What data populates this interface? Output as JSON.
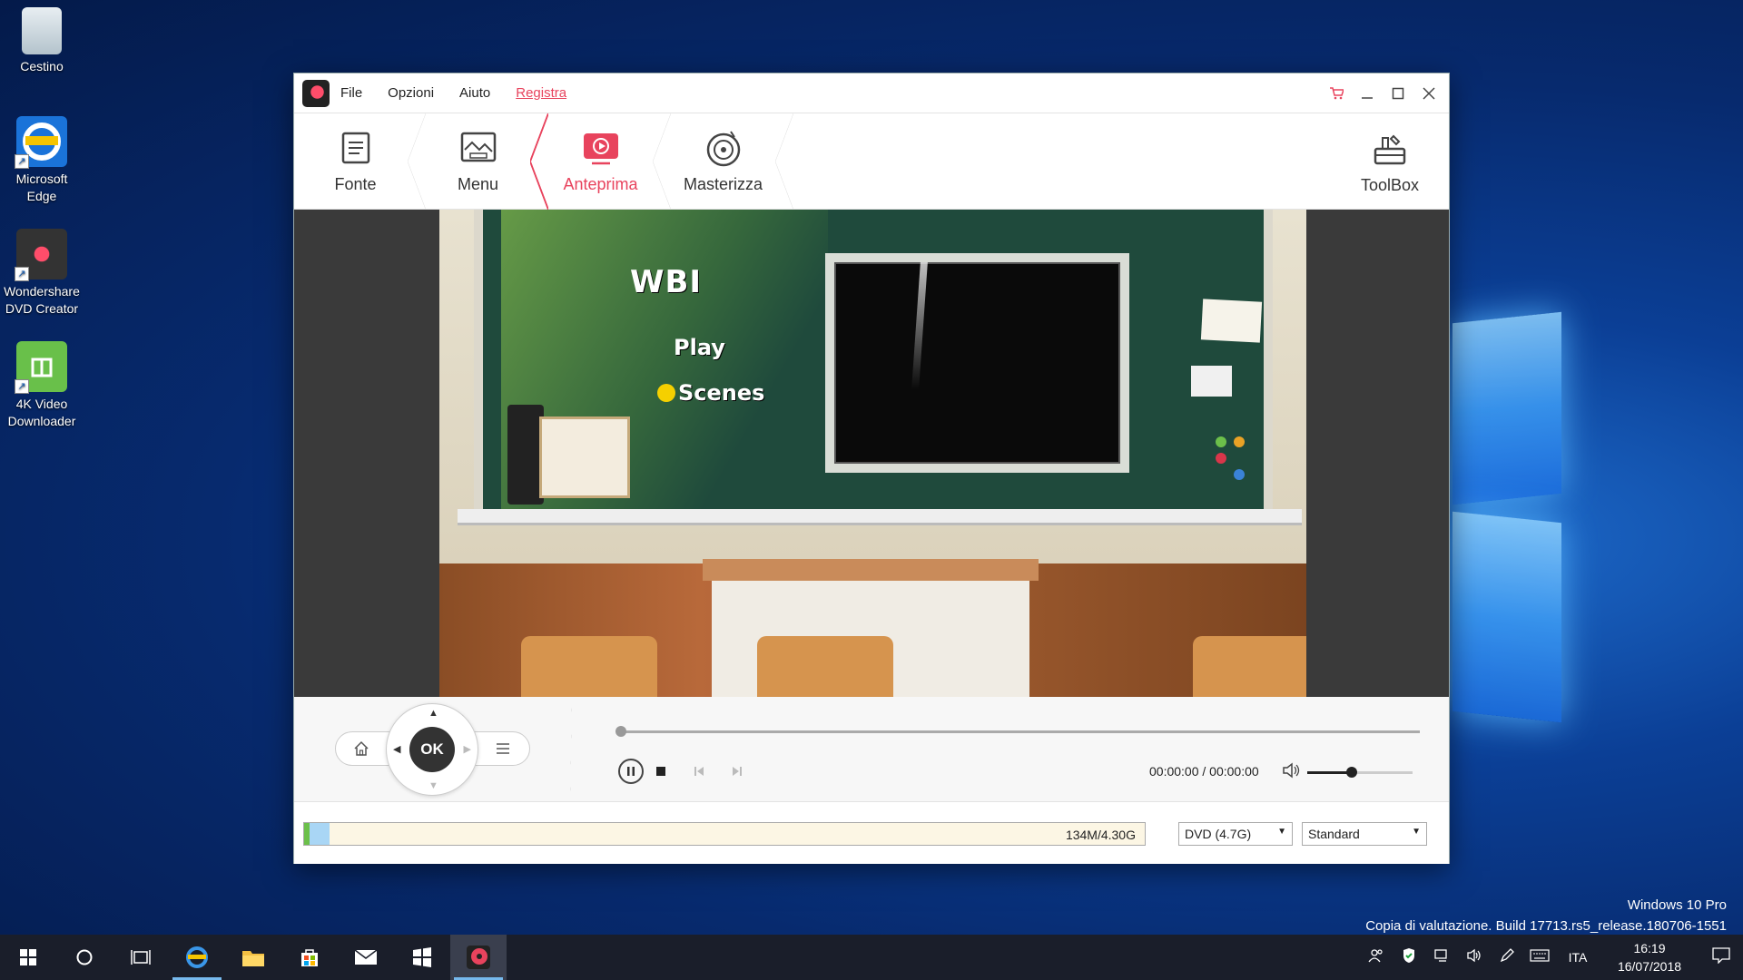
{
  "desktop": {
    "icons": [
      {
        "label": "Cestino"
      },
      {
        "label": "Microsoft Edge"
      },
      {
        "label": "Wondershare DVD Creator"
      },
      {
        "label": "4K Video Downloader"
      }
    ],
    "watermark": {
      "line1": "Windows 10 Pro",
      "line2": "Copia di valutazione. Build 17713.rs5_release.180706-1551"
    }
  },
  "app": {
    "menu": {
      "file": "File",
      "options": "Opzioni",
      "help": "Aiuto",
      "register": "Registra"
    },
    "steps": {
      "source": "Fonte",
      "menu": "Menu",
      "preview": "Anteprima",
      "burn": "Masterizza",
      "toolbox": "ToolBox"
    },
    "preview": {
      "menu_title": "WBI",
      "menu_play": "Play",
      "menu_scenes": "Scenes"
    },
    "remote": {
      "ok": "OK"
    },
    "player": {
      "time": "00:00:00 / 00:00:00",
      "volume_fraction": 0.42
    },
    "status": {
      "capacity_text": "134M/4.30G",
      "capacity_fraction": 0.03,
      "disc_type": "DVD (4.7G)",
      "quality": "Standard"
    },
    "accent_color": "#e8435d"
  },
  "taskbar": {
    "language": "ITA",
    "time": "16:19",
    "date": "16/07/2018"
  }
}
